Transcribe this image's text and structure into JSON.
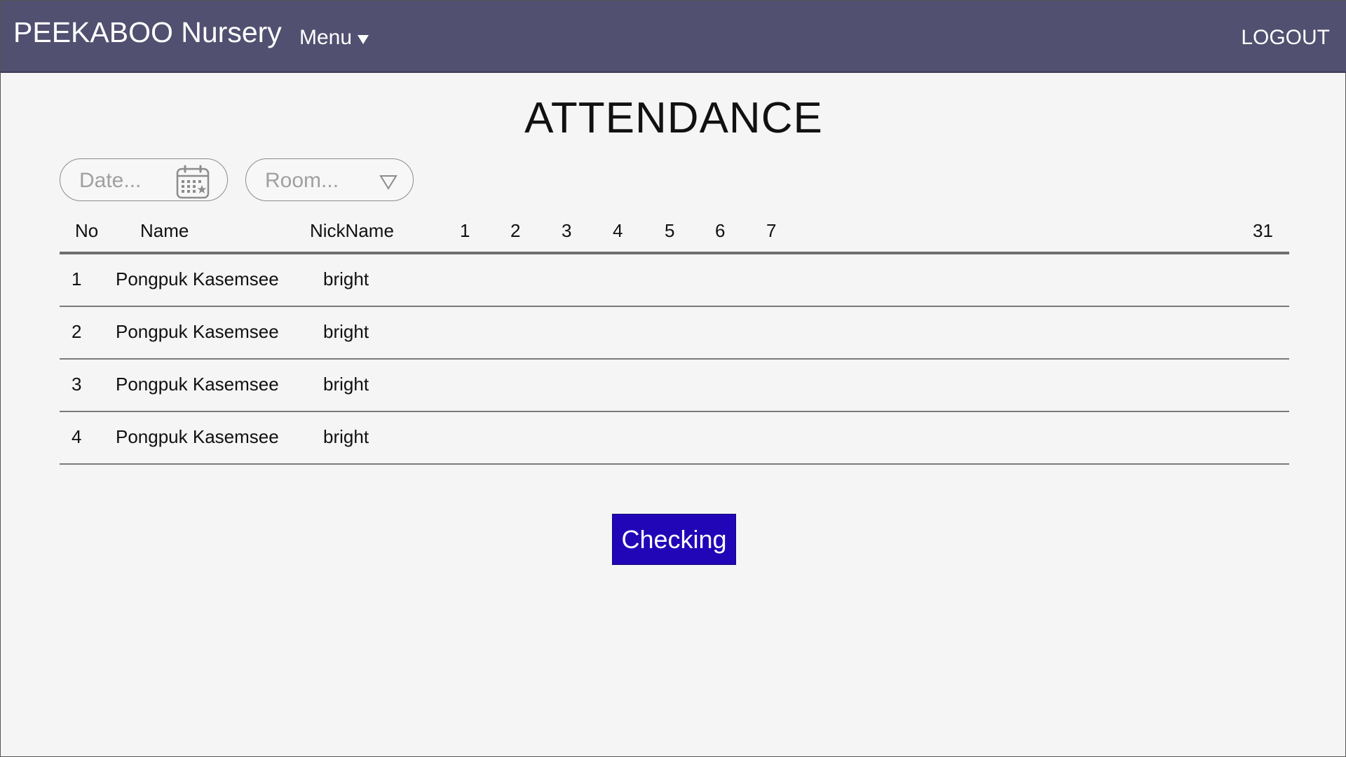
{
  "app": {
    "brand": "PEEKABOO Nursery"
  },
  "navbar": {
    "menu_label": "Menu",
    "logout_label": "LOGOUT",
    "background": "#525070"
  },
  "page": {
    "title": "ATTENDANCE"
  },
  "filters": {
    "date_placeholder": "Date...",
    "date_icon": "calendar-icon",
    "room_placeholder": "Room...",
    "room_icon": "dropdown-triangle-icon"
  },
  "table": {
    "headers": {
      "no": "No",
      "name": "Name",
      "nickname": "NickName",
      "days": [
        "1",
        "2",
        "3",
        "4",
        "5",
        "6",
        "7",
        "31"
      ]
    },
    "rows": [
      {
        "no": "1",
        "name": "Pongpuk Kasemsee",
        "nickname": "bright"
      },
      {
        "no": "2",
        "name": "Pongpuk Kasemsee",
        "nickname": "bright"
      },
      {
        "no": "3",
        "name": "Pongpuk Kasemsee",
        "nickname": "bright"
      },
      {
        "no": "4",
        "name": "Pongpuk Kasemsee",
        "nickname": "bright"
      }
    ]
  },
  "actions": {
    "checking_label": "Checking",
    "checking_color": "#2106b8"
  }
}
